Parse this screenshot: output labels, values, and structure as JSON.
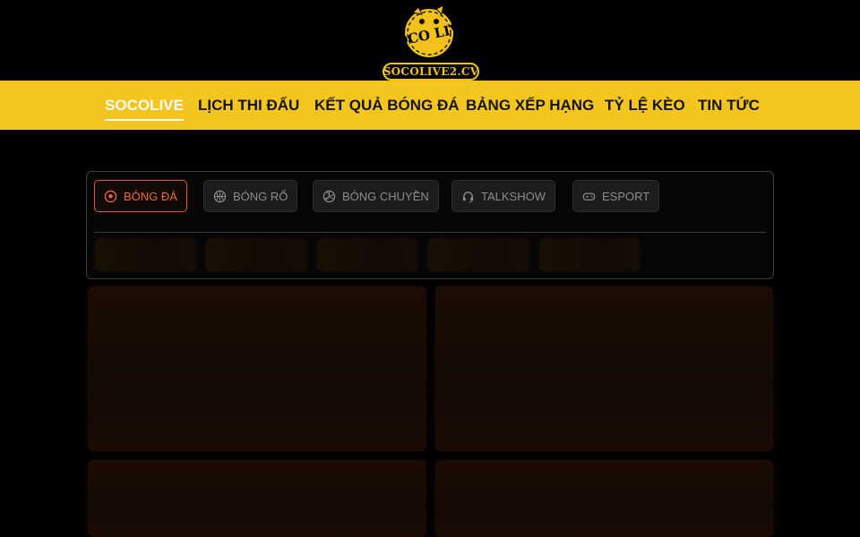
{
  "header": {
    "logo_text": "SOCOLIVE2.CV",
    "logo_emblem_text": "SOCO LIVE",
    "colors": {
      "brand_yellow": "#f4c51d",
      "background": "#000000"
    }
  },
  "nav": {
    "items": [
      {
        "label": "SOCOLIVE",
        "active": true
      },
      {
        "label": "LỊCH THI ĐẤU",
        "active": false
      },
      {
        "label": "KẾT QUẢ BÓNG ĐÁ",
        "active": false
      },
      {
        "label": "BẢNG XẾP HẠNG",
        "active": false
      },
      {
        "label": "TỶ LỆ KÈO",
        "active": false
      },
      {
        "label": "TIN TỨC",
        "active": false
      }
    ]
  },
  "sports_tabs": {
    "items": [
      {
        "label": "BÓNG ĐÁ",
        "icon": "soccer-ball-icon",
        "active": true
      },
      {
        "label": "BÓNG RỔ",
        "icon": "basketball-icon",
        "active": false
      },
      {
        "label": "BÓNG CHUYỀN",
        "icon": "volleyball-icon",
        "active": false
      },
      {
        "label": "TALKSHOW",
        "icon": "headset-icon",
        "active": false
      },
      {
        "label": "ESPORT",
        "icon": "gamepad-icon",
        "active": false
      }
    ],
    "accent_color": "#e25a2e"
  }
}
